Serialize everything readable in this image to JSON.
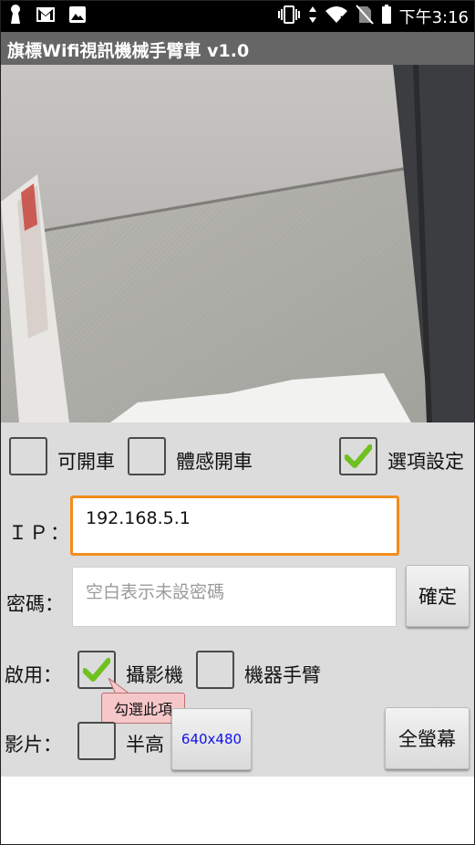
{
  "status_bar": {
    "time": "下午3:16",
    "icons": [
      "keyhole-icon",
      "gmail-icon",
      "image-icon",
      "vibrate-icon",
      "data-arrows-icon",
      "wifi-icon",
      "no-sim-icon",
      "battery-icon"
    ]
  },
  "app": {
    "title": "旗標Wifi視訊機械手臂車 v1.0"
  },
  "camera": {
    "label": "camera-view"
  },
  "controls": {
    "drive_label": "可開車",
    "drive_checked": false,
    "motion_label": "體感開車",
    "motion_checked": false,
    "options_label": "選項設定",
    "options_checked": true,
    "ip_label": "ＩＰ：",
    "ip_value": "192.168.5.1",
    "password_label": "密碼：",
    "password_placeholder": "空白表示未設密碼",
    "confirm_label": "確定",
    "enable_label": "啟用：",
    "camera_label": "攝影機",
    "camera_checked": true,
    "arm_label": "機器手臂",
    "arm_checked": false,
    "tooltip": "勾選此項",
    "video_label": "影片：",
    "half_height_label": "半高",
    "half_height_checked": false,
    "resolution_label": "640x480",
    "fullscreen_label": "全螢幕"
  },
  "colors": {
    "accent": "#f28c1c",
    "check": "#6fc11f",
    "link_text": "#1010ee"
  }
}
